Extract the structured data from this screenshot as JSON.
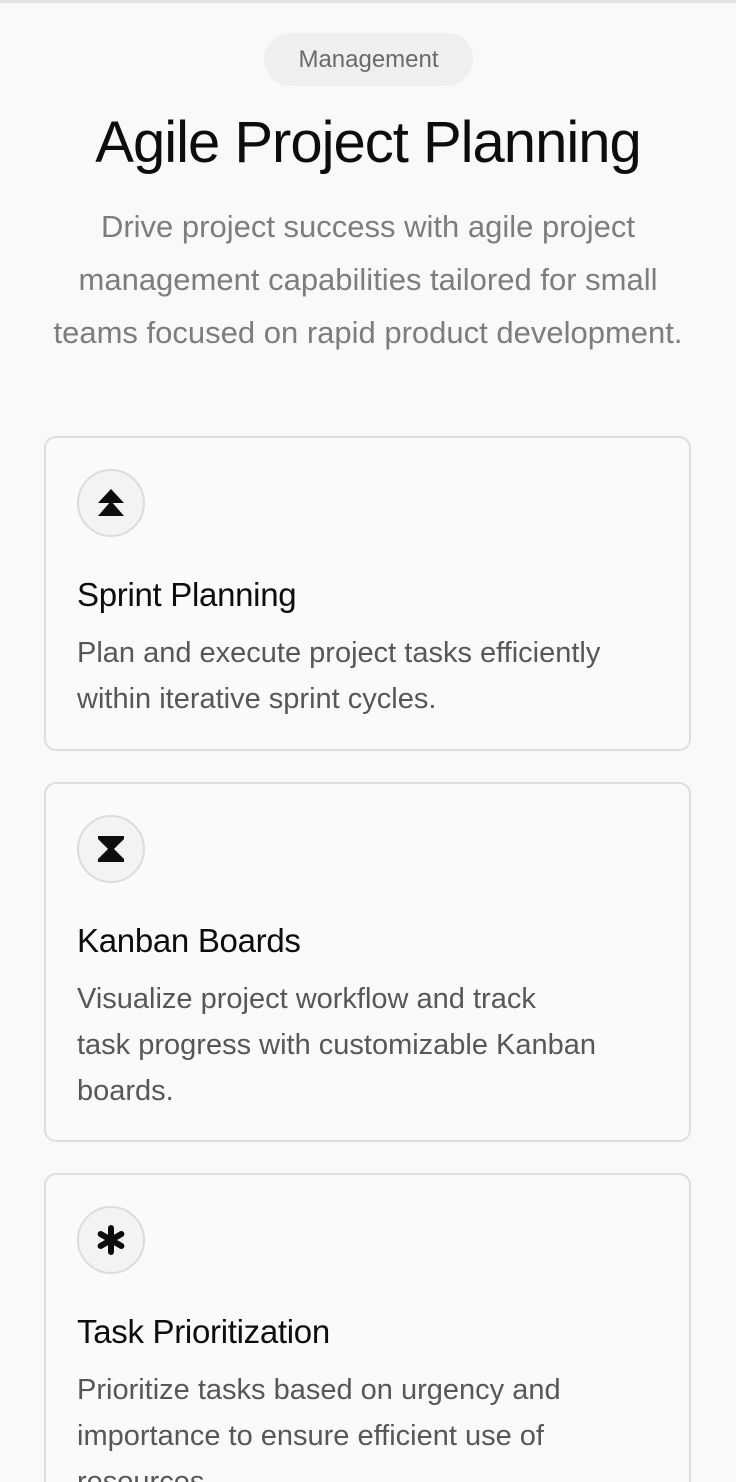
{
  "header": {
    "badge": "Management",
    "title": "Agile Project Planning",
    "subtitle": "Drive project success with agile project management capabilities tailored for small teams focused on rapid product development."
  },
  "features": [
    {
      "icon": "double-chevron-up-icon",
      "title": "Sprint Planning",
      "description": "Plan and execute project tasks efficiently within iterative sprint cycles."
    },
    {
      "icon": "hourglass-icon",
      "title": "Kanban Boards",
      "description": "Visualize project workflow and track task progress with customizable Kanban boards."
    },
    {
      "icon": "asterisk-icon",
      "title": "Task Prioritization",
      "description": "Prioritize tasks based on urgency and importance to ensure efficient use of resources."
    }
  ],
  "colors": {
    "background": "#f9f9f9",
    "badge_bg": "#efefef",
    "card_border": "#dedede",
    "title": "#0d0d0d",
    "muted": "#7d7d7d"
  }
}
